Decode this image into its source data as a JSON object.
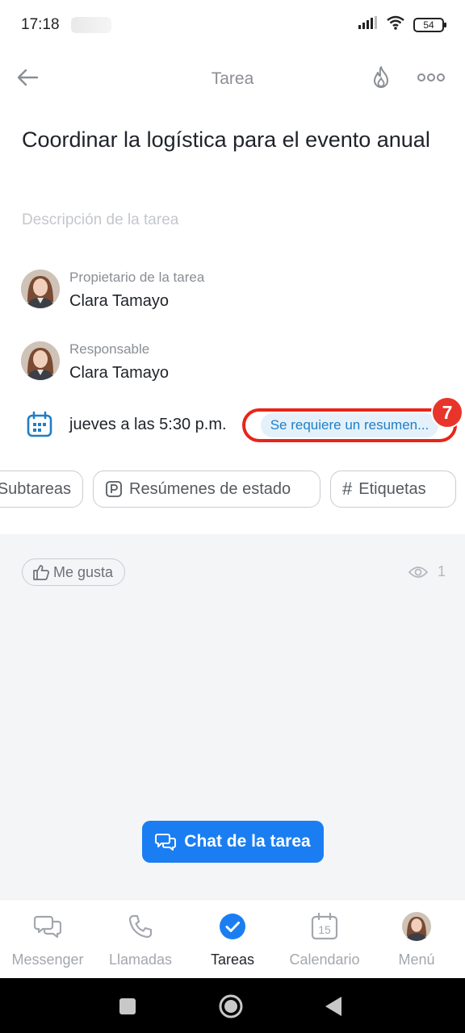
{
  "status_bar": {
    "time": "17:18",
    "battery": "54"
  },
  "header": {
    "title": "Tarea"
  },
  "task": {
    "title": "Coordinar la logística para el evento anual",
    "description_placeholder": "Descripción de la tarea"
  },
  "owner": {
    "label": "Propietario de la tarea",
    "name": "Clara Tamayo"
  },
  "responsible": {
    "label": "Responsable",
    "name": "Clara Tamayo"
  },
  "deadline": {
    "text": "jueves a las 5:30 p.m.",
    "summary_badge": "Se requiere un resumen...",
    "step_number": "7"
  },
  "chips": {
    "subtasks": "Subtareas",
    "status_summaries": "Resúmenes de estado",
    "tags": "Etiquetas"
  },
  "feed": {
    "like_label": "Me gusta",
    "view_count": "1",
    "chat_button": "Chat de la tarea"
  },
  "bottom_nav": {
    "items": [
      {
        "label": "Messenger",
        "icon": "chat-bubbles-icon"
      },
      {
        "label": "Llamadas",
        "icon": "phone-icon"
      },
      {
        "label": "Tareas",
        "icon": "check-circle-icon"
      },
      {
        "label": "Calendario",
        "icon": "calendar-icon",
        "day": "15"
      },
      {
        "label": "Menú",
        "icon": "avatar"
      }
    ]
  },
  "colors": {
    "accent": "#1a7ef2",
    "highlight_ring": "#e8251a",
    "badge_bg": "#e4f1fb"
  }
}
